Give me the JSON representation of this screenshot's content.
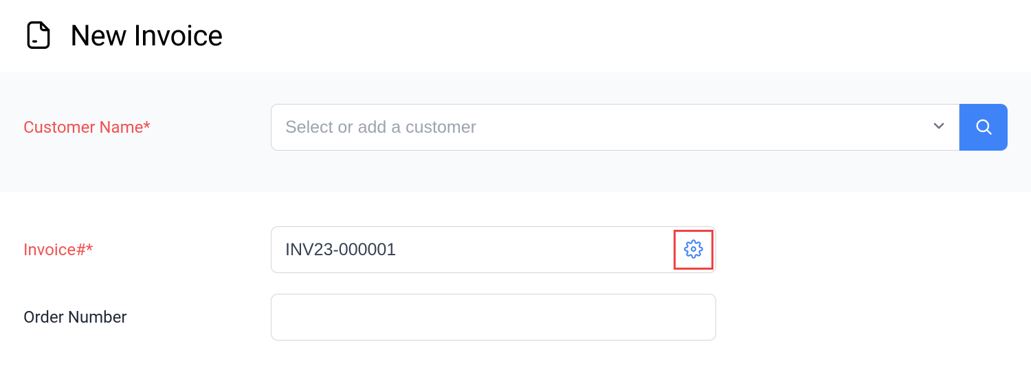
{
  "header": {
    "title": "New Invoice"
  },
  "customer": {
    "label": "Customer Name*",
    "placeholder": "Select or add a customer"
  },
  "invoice": {
    "label": "Invoice#*",
    "value": "INV23-000001"
  },
  "order": {
    "label": "Order Number",
    "value": ""
  }
}
